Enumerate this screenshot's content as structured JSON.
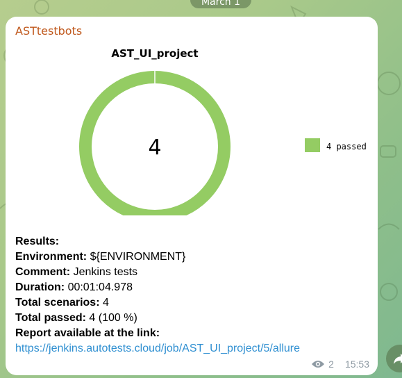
{
  "date_label": "March 1",
  "sender": "ASTtestbots",
  "chart_data": {
    "type": "pie",
    "title": "AST_UI_project",
    "center_label": "4",
    "slices": [
      {
        "name": "4 passed",
        "value": 4,
        "color": "#94cc63"
      }
    ],
    "legend_position": "right"
  },
  "message": {
    "results_label": "Results:",
    "environment_label": "Environment:",
    "environment_value": "${ENVIRONMENT}",
    "comment_label": "Comment:",
    "comment_value": "Jenkins tests",
    "duration_label": "Duration:",
    "duration_value": "00:01:04.978",
    "total_scenarios_label": "Total scenarios:",
    "total_scenarios_value": "4",
    "total_passed_label": "Total passed:",
    "total_passed_value": "4 (100 %)",
    "report_label": "Report available at the link:",
    "report_link": "https://jenkins.autotests.cloud/job/AST_UI_project/5/allure"
  },
  "meta": {
    "views": "2",
    "time": "15:53",
    "view_icon": "eye-icon"
  },
  "share_icon": "share-arrow-icon"
}
